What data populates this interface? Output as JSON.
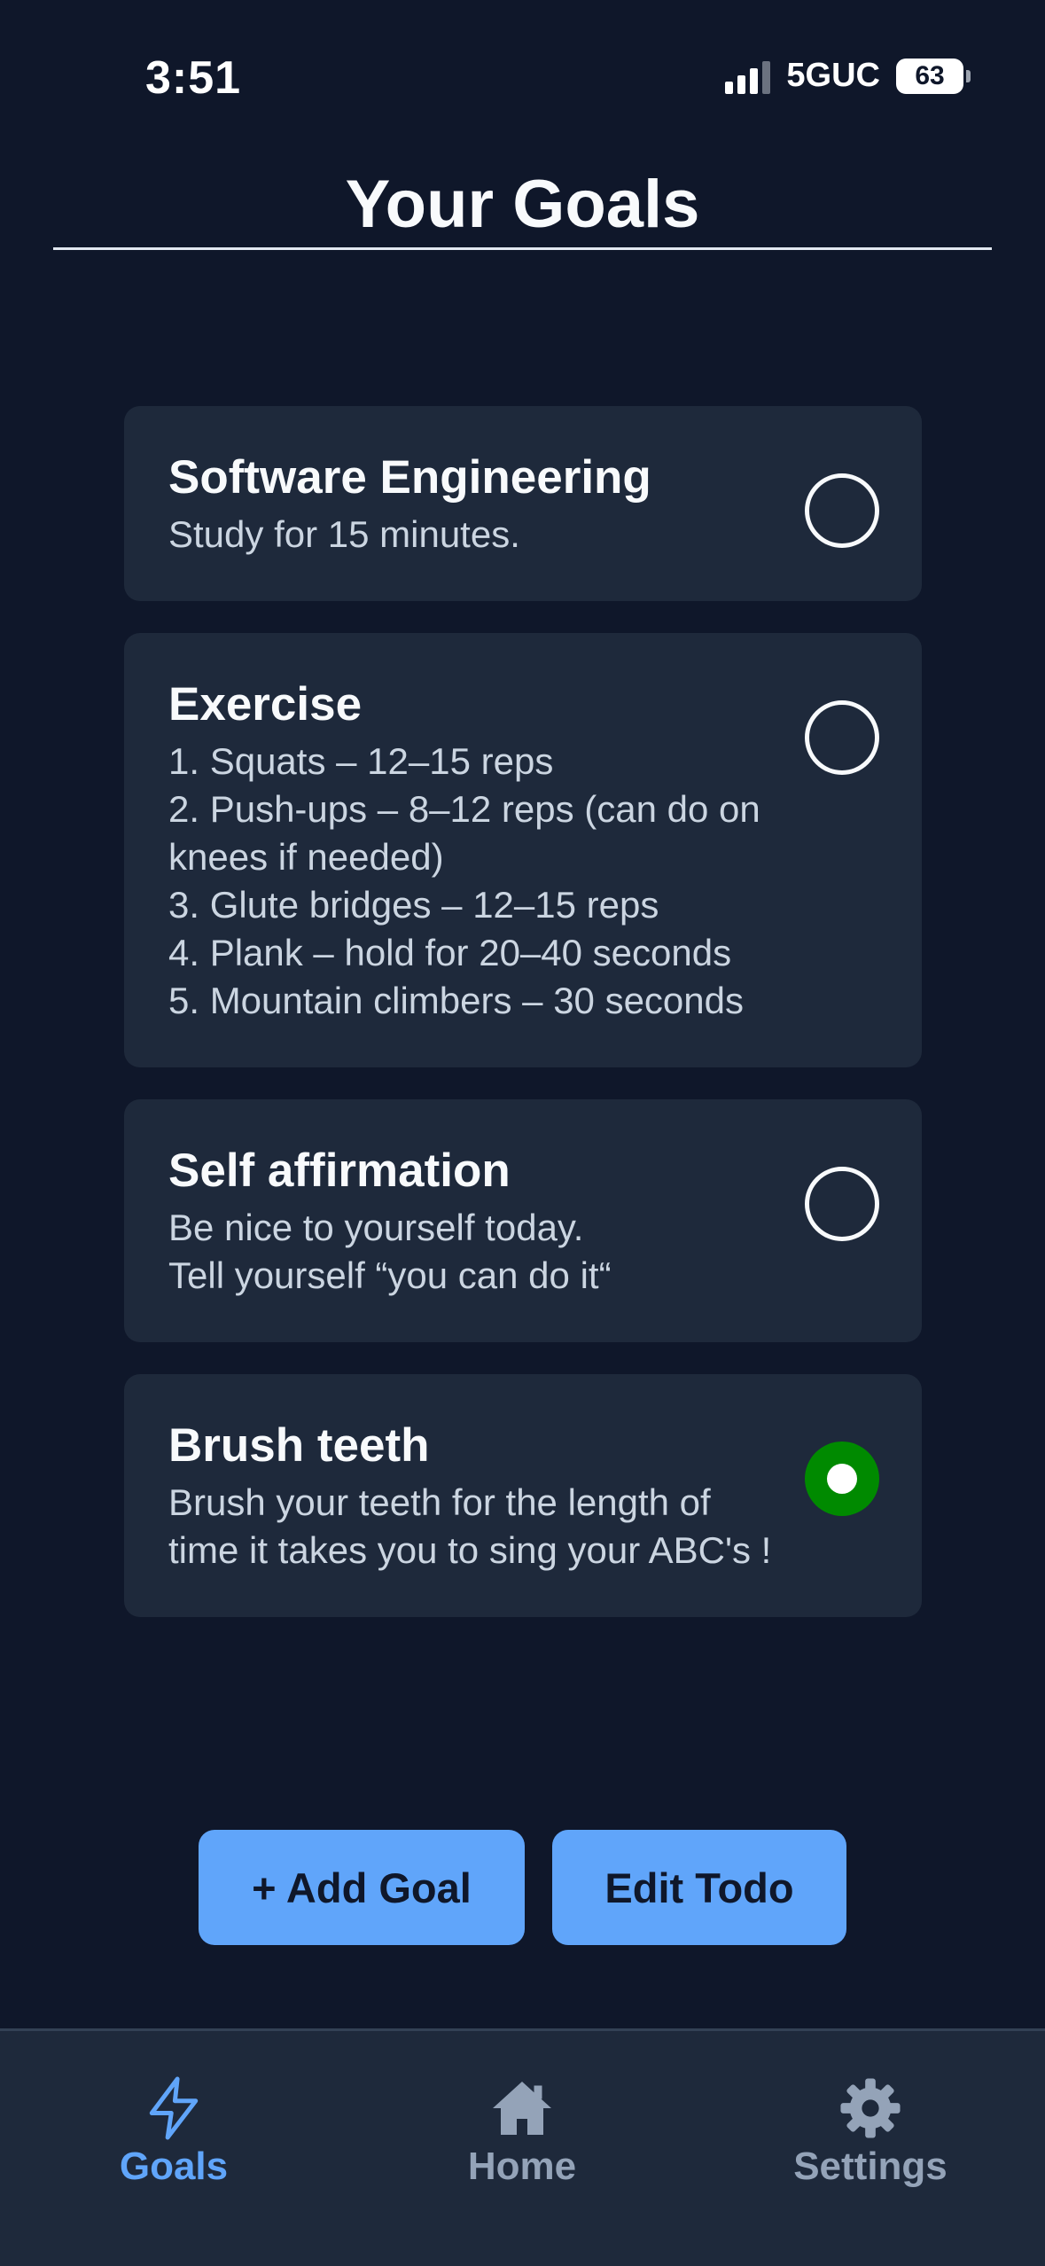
{
  "status_bar": {
    "time": "3:51",
    "network": "5GUC",
    "battery": "63"
  },
  "header": {
    "title": "Your Goals"
  },
  "goals": [
    {
      "title": "Software Engineering",
      "description": "Study for 15 minutes.",
      "completed": false
    },
    {
      "title": "Exercise",
      "description": "1.    Squats – 12–15 reps\n2.    Push-ups – 8–12 reps (can do on knees if needed)\n3.    Glute bridges – 12–15 reps\n4.    Plank – hold for 20–40 seconds\n5.    Mountain climbers – 30 seconds",
      "completed": false
    },
    {
      "title": "Self affirmation",
      "description": "Be nice to yourself today.\nTell yourself “you can do it“",
      "completed": false
    },
    {
      "title": "Brush teeth",
      "description": "Brush your teeth for the length of time it takes you to sing your ABC's !",
      "completed": true
    }
  ],
  "actions": {
    "add_goal": "+ Add Goal",
    "edit_todo": "Edit Todo"
  },
  "tabbar": {
    "goals": "Goals",
    "home": "Home",
    "settings": "Settings",
    "active": "goals"
  },
  "colors": {
    "background": "#0f172a",
    "card": "#1e293b",
    "accent": "#60a5fa",
    "done": "#008a00"
  },
  "icons": {
    "goals": "lightning-icon",
    "home": "home-icon",
    "settings": "gear-icon"
  }
}
